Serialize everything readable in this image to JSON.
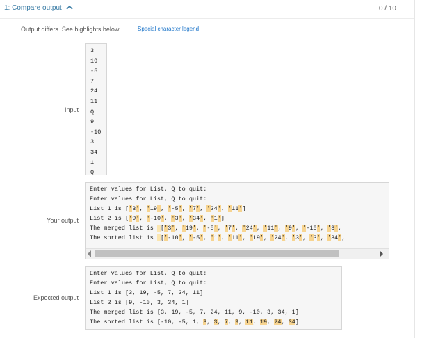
{
  "header": {
    "title": "1: Compare output",
    "score": "0 / 10"
  },
  "diff_message": "Output differs. See highlights below.",
  "legend_link": "Special character legend",
  "input": {
    "label": "Input",
    "lines": [
      "3",
      "19",
      "-5",
      "7",
      "24",
      "11",
      "Q",
      "9",
      "-10",
      "3",
      "34",
      "1",
      "Q"
    ]
  },
  "your_output": {
    "label": "Your output",
    "lines": [
      "Enter values for List, Q to quit:",
      "Enter values for List, Q to quit:",
      "List 1 is ['3', '19', '-5', '7', '24', '11']",
      "List 2 is ['9', '-10', '3', '34', '1']",
      "The merged list is  ['3', '19', '-5', '7', '24', '11', '9', '-10', '3',",
      "The sorted list is  ['-10', '-5', '1', '11', '19', '24', '3', '3', '34',"
    ]
  },
  "expected_output": {
    "label": "Expected output",
    "lines": [
      "Enter values for List, Q to quit:",
      "Enter values for List, Q to quit:",
      "List 1 is [3, 19, -5, 7, 24, 11]",
      "List 2 is [9, -10, 3, 34, 1]",
      "The merged list is [3, 19, -5, 7, 24, 11, 9, -10, 3, 34, 1]",
      "The sorted list is [-10, -5, 1, 3, 3, 7, 9, 11, 19, 24, 34]"
    ]
  },
  "colors": {
    "highlight": "#f7d490",
    "link": "#1a73c8",
    "title": "#3a7ca5"
  }
}
